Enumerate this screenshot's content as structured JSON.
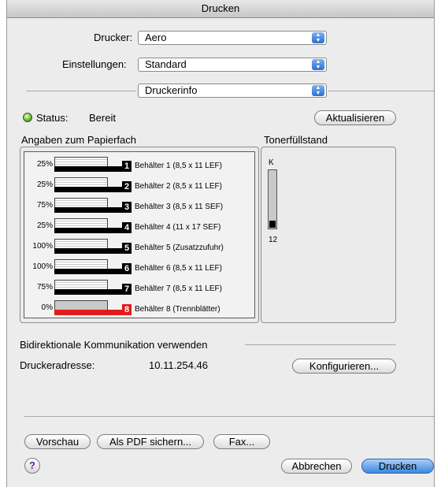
{
  "window": {
    "title": "Drucken"
  },
  "printer": {
    "label": "Drucker:",
    "value": "Aero"
  },
  "presets": {
    "label": "Einstellungen:",
    "value": "Standard"
  },
  "panel": {
    "value": "Druckerinfo"
  },
  "status": {
    "label": "Status:",
    "value": "Bereit",
    "refresh_label": "Aktualisieren"
  },
  "paper": {
    "title": "Angaben zum Papierfach",
    "trays": [
      {
        "percent": "25%",
        "fill": 0.25,
        "number": "1",
        "name": "Behälter 1 (8,5 x 11 LEF)",
        "empty": false
      },
      {
        "percent": "25%",
        "fill": 0.25,
        "number": "2",
        "name": "Behälter 2 (8,5 x 11 LEF)",
        "empty": false
      },
      {
        "percent": "75%",
        "fill": 0.75,
        "number": "3",
        "name": "Behälter 3 (8,5 x 11 SEF)",
        "empty": false
      },
      {
        "percent": "25%",
        "fill": 0.25,
        "number": "4",
        "name": "Behälter 4 (11 x 17 SEF)",
        "empty": false
      },
      {
        "percent": "100%",
        "fill": 1.0,
        "number": "5",
        "name": "Behälter 5 (Zusatzzufuhr)",
        "empty": false
      },
      {
        "percent": "100%",
        "fill": 1.0,
        "number": "6",
        "name": "Behälter 6 (8,5 x 11 LEF)",
        "empty": false
      },
      {
        "percent": "75%",
        "fill": 0.75,
        "number": "7",
        "name": "Behälter 7 (8,5 x 11 LEF)",
        "empty": false
      },
      {
        "percent": "0%",
        "fill": 0.0,
        "number": "8",
        "name": "Behälter 8 (Trennblätter)",
        "empty": true
      }
    ]
  },
  "toner": {
    "title": "Tonerfüllstand",
    "color_label": "K",
    "level": 12,
    "level_text": "12"
  },
  "bidi": {
    "label": "Bidirektionale Kommunikation verwenden"
  },
  "address": {
    "label": "Druckeradresse:",
    "value": "10.11.254.46",
    "configure_label": "Konfigurieren..."
  },
  "buttons": {
    "preview": "Vorschau",
    "save_pdf": "Als PDF sichern...",
    "fax": "Fax...",
    "help": "?",
    "cancel": "Abbrechen",
    "print": "Drucken"
  },
  "colors": {
    "accent": "#3d87e0",
    "status_ok": "#67c221",
    "tray_empty": "#e21b1b"
  }
}
